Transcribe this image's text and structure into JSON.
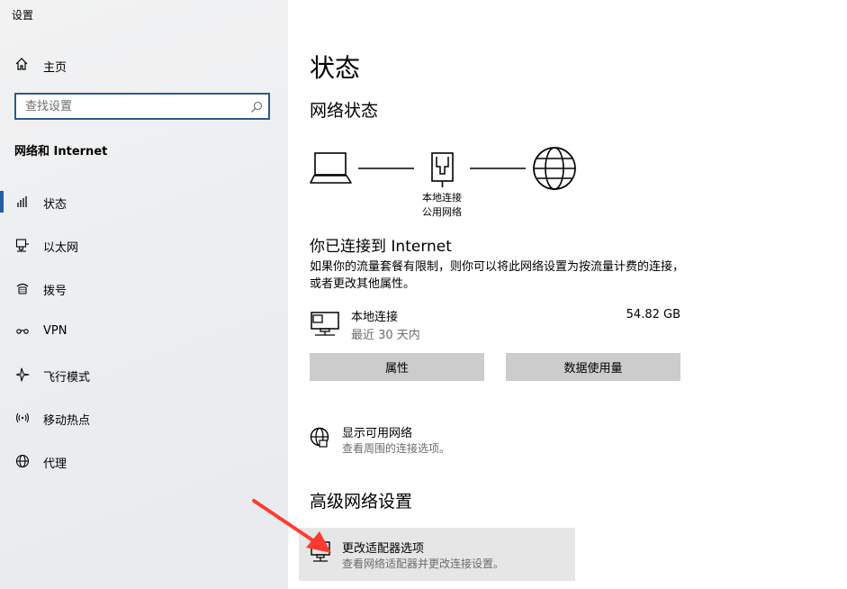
{
  "window": {
    "title": "设置"
  },
  "sidebar": {
    "home_label": "主页",
    "search_placeholder": "查找设置",
    "section_title": "网络和 Internet",
    "accent": "#1f5fa8",
    "items": [
      {
        "label": "状态",
        "icon": "status-icon",
        "selected": true
      },
      {
        "label": "以太网",
        "icon": "ethernet-icon",
        "selected": false
      },
      {
        "label": "拨号",
        "icon": "dialup-icon",
        "selected": false
      },
      {
        "label": "VPN",
        "icon": "vpn-icon",
        "selected": false
      },
      {
        "label": "飞行模式",
        "icon": "airplane-icon",
        "selected": false
      },
      {
        "label": "移动热点",
        "icon": "hotspot-icon",
        "selected": false
      },
      {
        "label": "代理",
        "icon": "globe-icon",
        "selected": false
      }
    ]
  },
  "main": {
    "title": "状态",
    "network_status_heading": "网络状态",
    "diagram": {
      "connection_name": "本地连接",
      "network_type": "公用网络"
    },
    "connected_heading": "你已连接到 Internet",
    "metered_desc": "如果你的流量套餐有限制，则你可以将此网络设置为按流量计费的连接，或者更改其他属性。",
    "adapter": {
      "name": "本地连接",
      "period": "最近 30 天内",
      "usage": "54.82 GB"
    },
    "buttons": {
      "properties": "属性",
      "data_usage": "数据使用量"
    },
    "show_networks": {
      "title": "显示可用网络",
      "subtitle": "查看周围的连接选项。"
    },
    "advanced_heading": "高级网络设置",
    "change_adapter": {
      "title": "更改适配器选项",
      "subtitle": "查看网络适配器并更改连接设置。"
    }
  },
  "annotation": {
    "arrow_color": "#ff3b30"
  }
}
